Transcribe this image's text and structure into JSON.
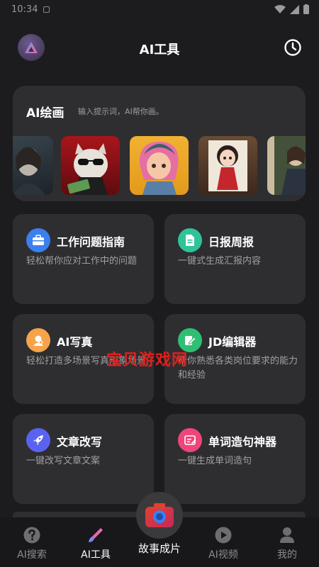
{
  "status": {
    "time": "10:34"
  },
  "header": {
    "title": "AI工具",
    "avatar_icon": "triangle-logo-icon",
    "history_icon": "clock-icon"
  },
  "draw": {
    "title": "AI绘画",
    "subtitle": "输入提示词，AI帮你画。",
    "images": [
      "woman-portrait-image",
      "cat-sunglasses-image",
      "pink-hair-girl-image",
      "red-dress-doll-image",
      "painting-woman-image"
    ]
  },
  "tools": [
    {
      "title": "工作问题指南",
      "desc": "轻松帮你应对工作中的问题",
      "icon": "briefcase-icon",
      "color": "#3b7ff0"
    },
    {
      "title": "日报周报",
      "desc": "一键式生成汇报内容",
      "icon": "document-icon",
      "color": "#2fc39a"
    },
    {
      "title": "AI写真",
      "desc": "轻松打造多场景写真形象场景",
      "icon": "portrait-icon",
      "color": "#f5a44a"
    },
    {
      "title": "JD编辑器",
      "desc": "帮你熟悉各类岗位要求的能力和经验",
      "icon": "edit-icon",
      "color": "#2fbf74"
    },
    {
      "title": "文章改写",
      "desc": "一键改写文章文案",
      "icon": "rocket-icon",
      "color": "#5a63f0"
    },
    {
      "title": "单词造句神器",
      "desc": "一键生成单词造句",
      "icon": "pen-list-icon",
      "color": "#f0457a"
    }
  ],
  "watermark": "宝贝游戏网",
  "tabbar": {
    "items": [
      {
        "label": "AI搜索",
        "icon": "question-icon"
      },
      {
        "label": "AI工具",
        "icon": "brush-icon"
      },
      {
        "label": "故事成片",
        "icon": "camera-icon"
      },
      {
        "label": "AI视频",
        "icon": "play-icon"
      },
      {
        "label": "我的",
        "icon": "user-icon"
      }
    ],
    "active": "AI工具"
  }
}
